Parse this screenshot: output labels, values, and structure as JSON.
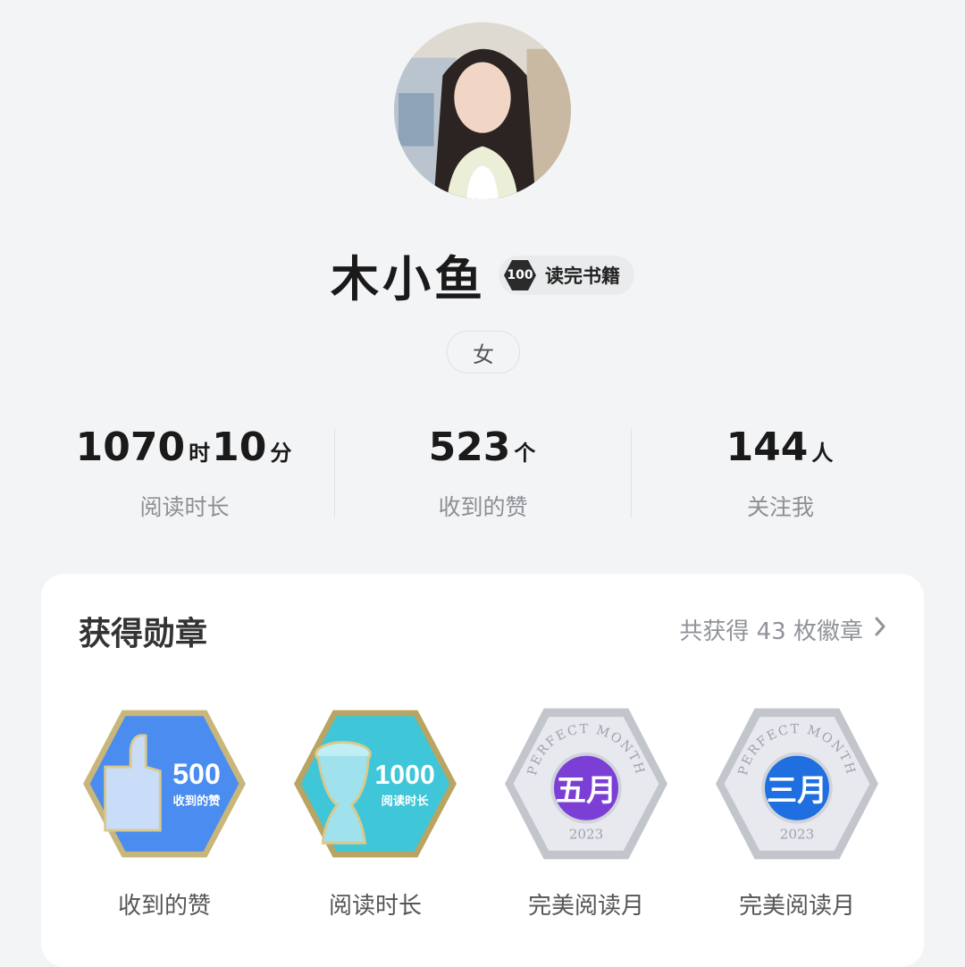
{
  "profile": {
    "name": "木小鱼",
    "read_badge": {
      "count": "100",
      "label": "读完书籍"
    },
    "gender": "女"
  },
  "stats": [
    {
      "value_hours": "1070",
      "unit_hours": "时",
      "value_minutes": "10",
      "unit_minutes": "分",
      "caption": "阅读时长"
    },
    {
      "value": "523",
      "unit": "个",
      "caption": "收到的赞"
    },
    {
      "value": "144",
      "unit": "人",
      "caption": "关注我"
    }
  ],
  "medals_section": {
    "title": "获得勋章",
    "summary": "共获得 43 枚徽章",
    "chevron": "chevron-right-icon",
    "medals": [
      {
        "label": "收到的赞",
        "badge_number": "500",
        "badge_text": "收到的赞",
        "icon": "thumbs-up-icon",
        "color": "#4a8cf0"
      },
      {
        "label": "阅读时长",
        "badge_number": "1000",
        "badge_text": "阅读时长",
        "icon": "cup-icon",
        "color": "#3fc6d9"
      },
      {
        "label": "完美阅读月",
        "arc_text": "PERFECT MONTH",
        "center_text": "五月",
        "year": "2023",
        "color": "#7b3fd6"
      },
      {
        "label": "完美阅读月",
        "arc_text": "PERFECT MONTH",
        "center_text": "三月",
        "year": "2023",
        "color": "#1f6fe0"
      }
    ]
  },
  "colors": {
    "background": "#f3f4f6",
    "card": "#ffffff",
    "muted_text": "#8c8f94"
  }
}
